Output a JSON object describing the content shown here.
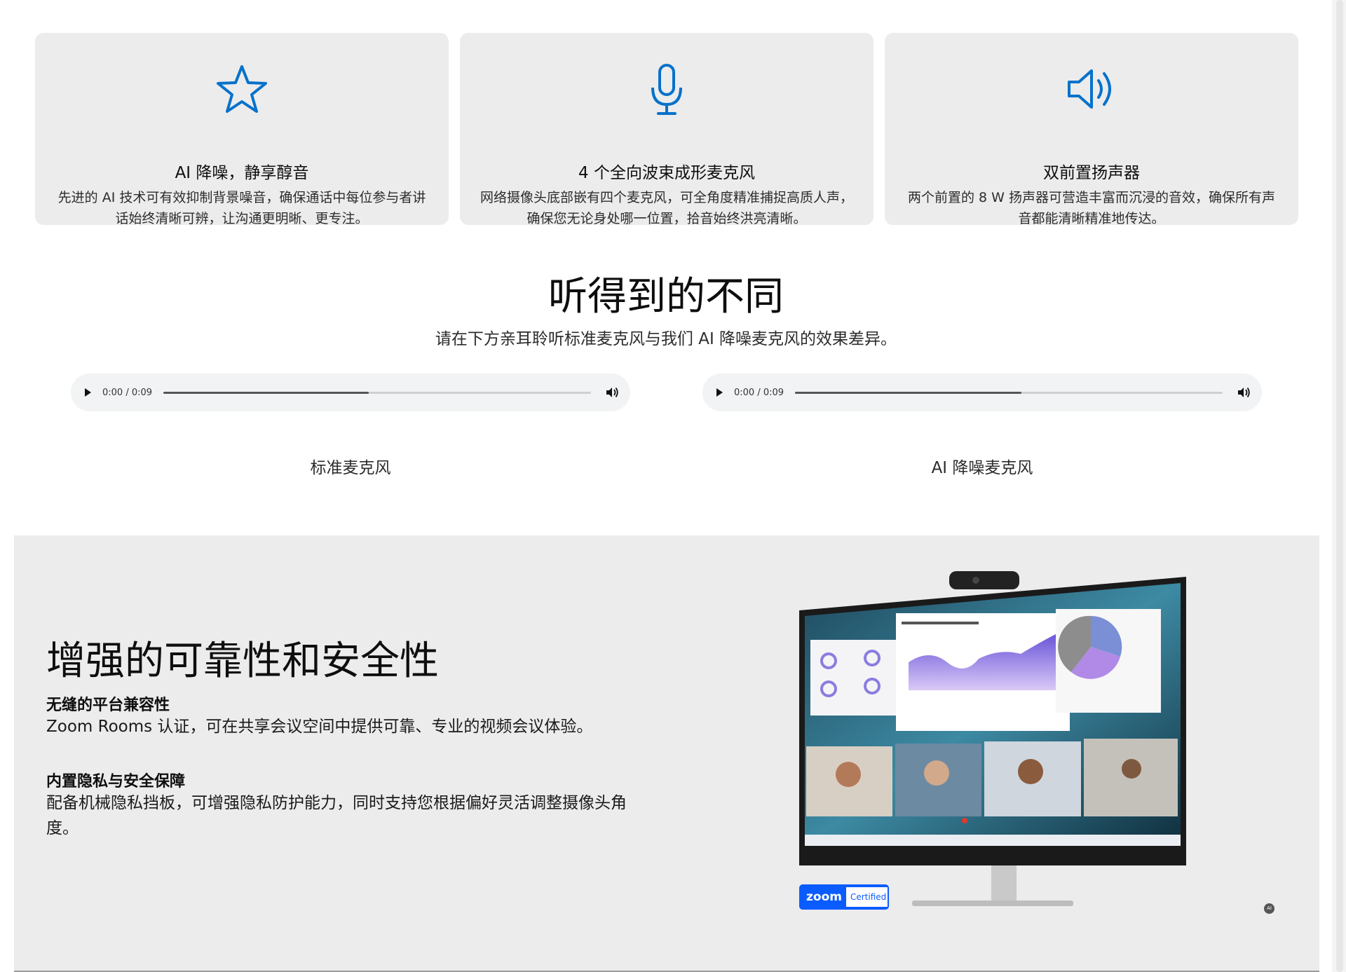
{
  "features": [
    {
      "icon": "star-icon",
      "title": "AI 降噪，静享醇音",
      "desc": "先进的 AI 技术可有效抑制背景噪音，确保通话中每位参与者讲话始终清晰可辨，让沟通更明晰、更专注。"
    },
    {
      "icon": "microphone-icon",
      "title": "4 个全向波束成形麦克风",
      "desc": "网络摄像头底部嵌有四个麦克风，可全角度精准捕捉高质人声，确保您无论身处哪一位置，拾音始终洪亮清晰。"
    },
    {
      "icon": "speaker-icon",
      "title": "双前置扬声器",
      "desc": "两个前置的 8 W 扬声器可营造丰富而沉浸的音效，确保所有声音都能清晰精准地传达。"
    }
  ],
  "compare": {
    "title": "听得到的不同",
    "subtitle": "请在下方亲耳聆听标准麦克风与我们 AI 降噪麦克风的效果差异。",
    "players": [
      {
        "time": "0:00 / 0:09",
        "progress": 0.48,
        "label": "标准麦克风"
      },
      {
        "time": "0:00 / 0:09",
        "progress": 0.53,
        "label": "AI 降噪麦克风"
      }
    ]
  },
  "reliability": {
    "title": "增强的可靠性和安全性",
    "items": [
      {
        "title": "无缝的平台兼容性",
        "desc": "Zoom Rooms 认证，可在共享会议空间中提供可靠、专业的视频会议体验。"
      },
      {
        "title": "内置隐私与安全保障",
        "desc": "配备机械隐私挡板，可增强隐私防护能力，同时支持您根据偏好灵活调整摄像头角度。"
      }
    ],
    "badge": {
      "logo": "zoom",
      "text": "Certified"
    },
    "ai_mark": "AI"
  },
  "colors": {
    "accent": "#0672cb",
    "card": "#ececec",
    "section": "#ececec",
    "zoom": "#0b5cff"
  }
}
